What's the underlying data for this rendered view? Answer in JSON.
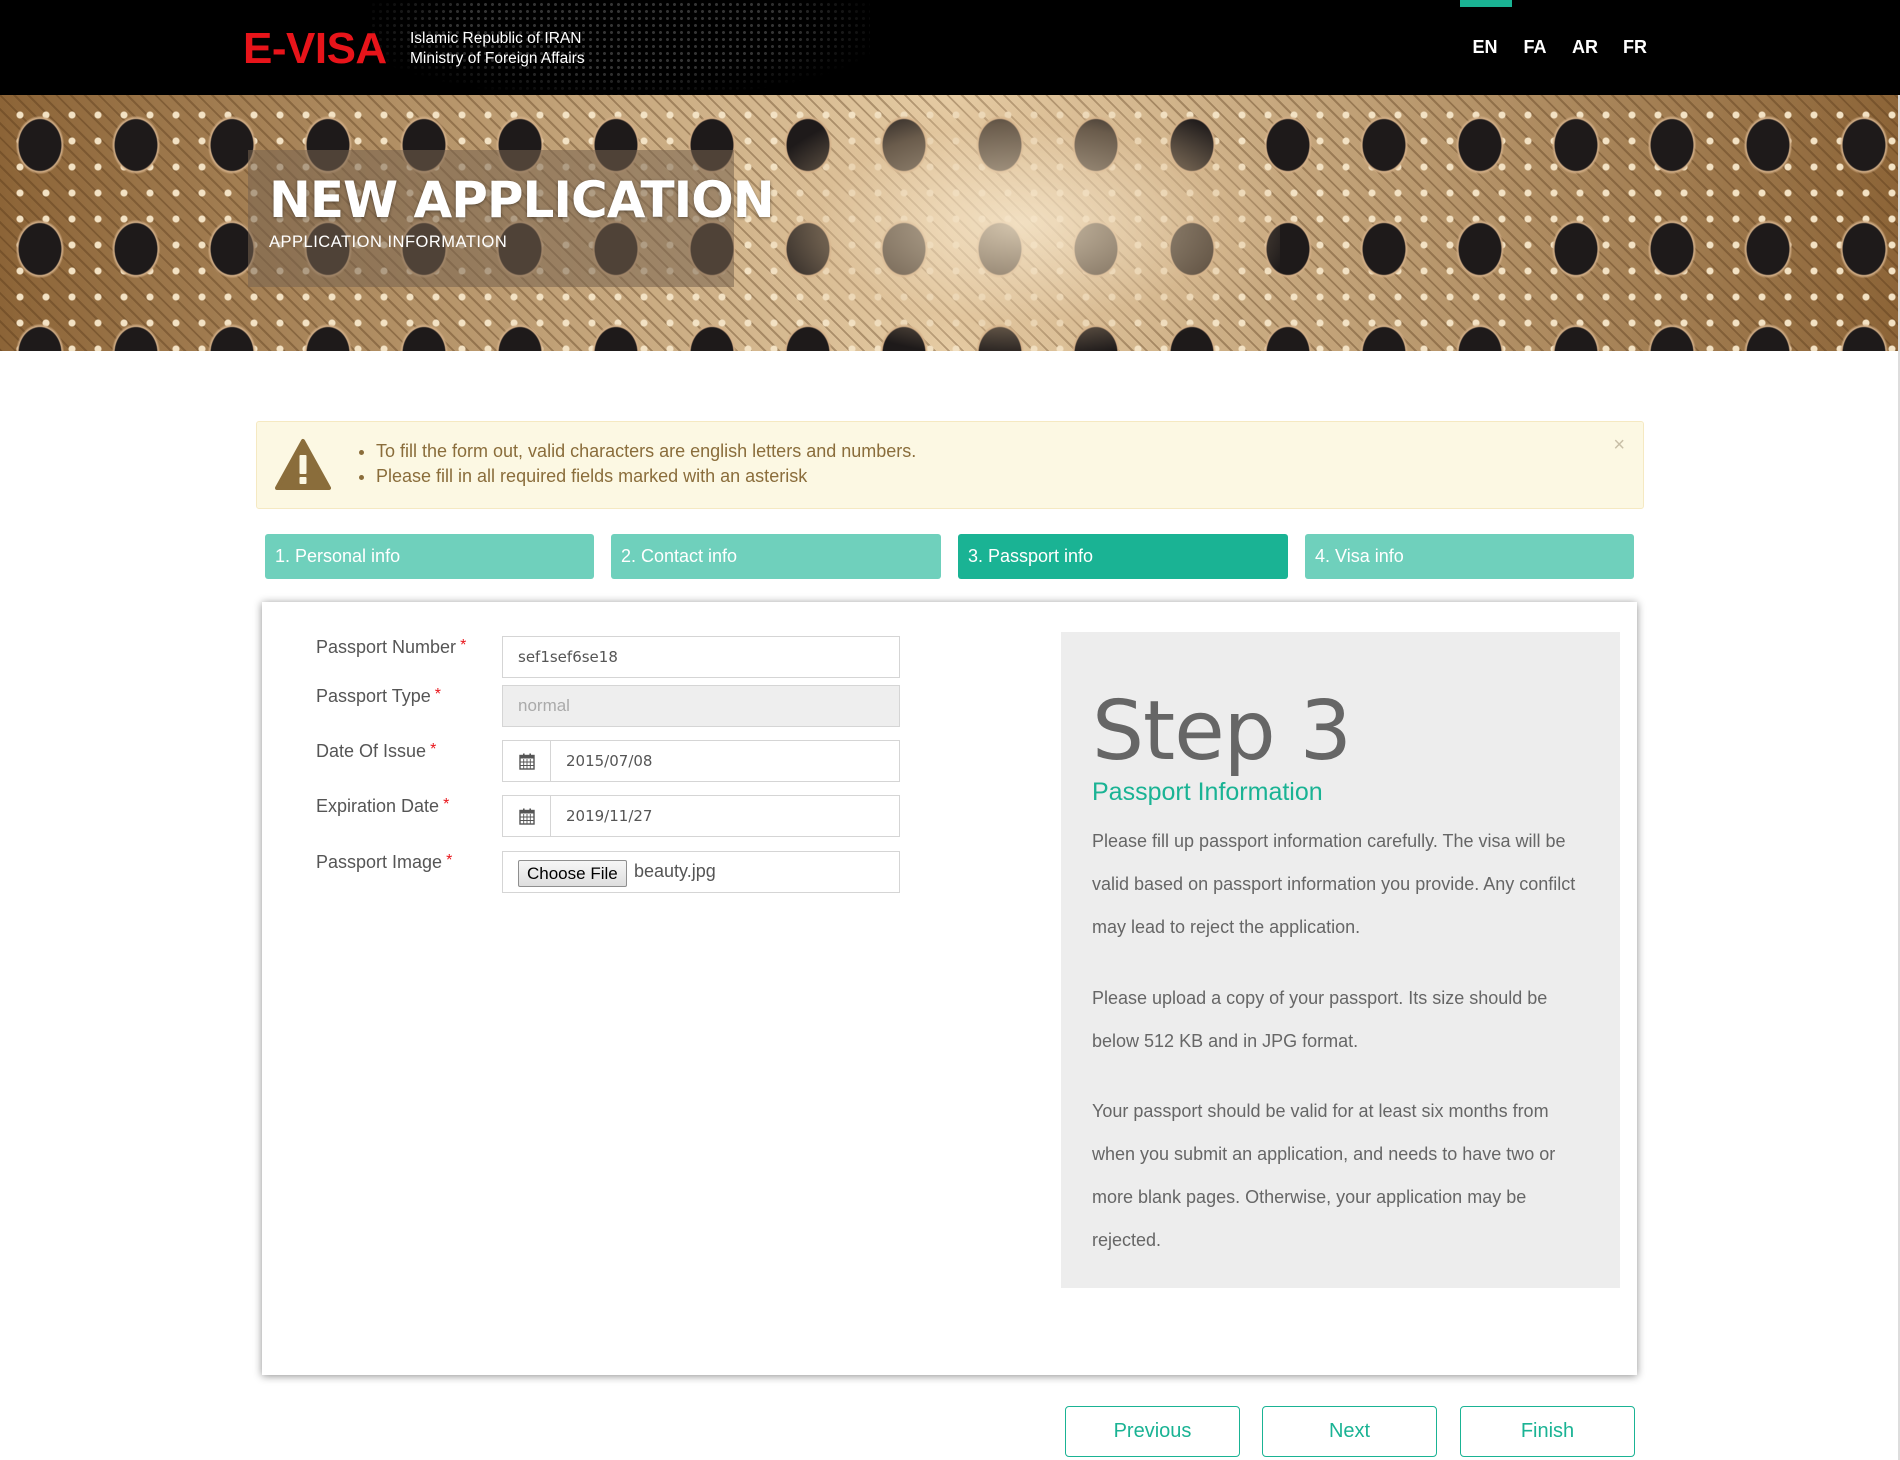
{
  "header": {
    "logo": "E-VISA",
    "ministry_line1": "Islamic Republic of IRAN",
    "ministry_line2": "Ministry of Foreign Affairs",
    "languages": [
      "EN",
      "FA",
      "AR",
      "FR"
    ],
    "active_language": "EN",
    "accent_color": "#1ab394",
    "logo_color": "#e8141a"
  },
  "banner": {
    "title": "NEW APPLICATION",
    "subtitle": "APPLICATION INFORMATION"
  },
  "alert": {
    "icon": "warning-icon",
    "items": [
      "To fill the form out, valid characters are english letters and numbers.",
      "Please fill in all required fields marked with an asterisk"
    ],
    "close_label": "×"
  },
  "steps": [
    {
      "label": "1. Personal info"
    },
    {
      "label": "2. Contact info"
    },
    {
      "label": "3. Passport info"
    },
    {
      "label": "4. Visa info"
    }
  ],
  "active_step": 3,
  "form": {
    "passport_number": {
      "label": "Passport Number",
      "value": "sef1sef6se18"
    },
    "passport_type": {
      "label": "Passport Type",
      "value": "normal"
    },
    "date_of_issue": {
      "label": "Date Of Issue",
      "value": "2015/07/08"
    },
    "expiration_date": {
      "label": "Expiration Date",
      "value": "2019/11/27"
    },
    "passport_image": {
      "label": "Passport Image",
      "button": "Choose File",
      "filename": "beauty.jpg"
    },
    "required_mark": "*"
  },
  "info_panel": {
    "heading": "Step 3",
    "subheading": "Passport Information",
    "paragraphs": [
      "Please fill up passport information carefully. The visa will be valid based on passport information you provide. Any confilct may lead to reject the application.",
      "Please upload a copy of your passport. Its size should be below 512 KB and in JPG format.",
      "Your passport should be valid for at least six months from when you submit an application, and needs to have two or more blank pages. Otherwise, your application may be rejected."
    ]
  },
  "buttons": {
    "previous": "Previous",
    "next": "Next",
    "finish": "Finish"
  }
}
